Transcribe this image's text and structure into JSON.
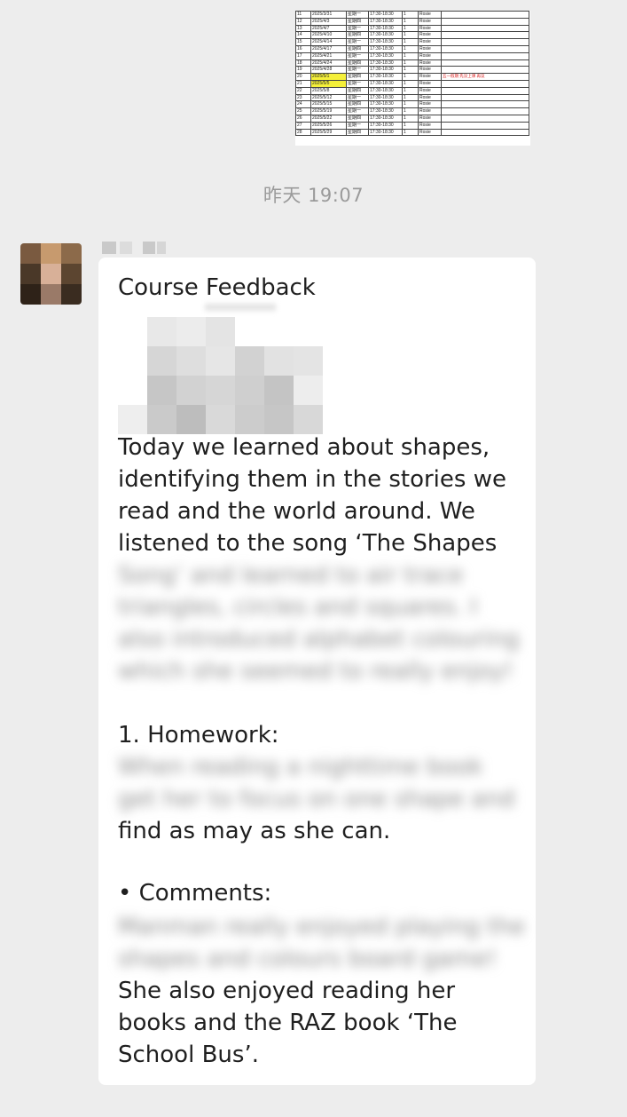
{
  "schedule": {
    "rows": [
      [
        "11",
        "2025/3/31",
        "星期一",
        "17:30-18:30",
        "1",
        "Rosie",
        ""
      ],
      [
        "12",
        "2025/4/3",
        "星期四",
        "17:30-18:30",
        "1",
        "Rosie",
        ""
      ],
      [
        "13",
        "2025/4/7",
        "星期一",
        "17:30-18:30",
        "1",
        "Rosie",
        ""
      ],
      [
        "14",
        "2025/4/10",
        "星期四",
        "17:30-18:30",
        "1",
        "Rosie",
        ""
      ],
      [
        "15",
        "2025/4/14",
        "星期一",
        "17:30-18:30",
        "1",
        "Rosie",
        ""
      ],
      [
        "16",
        "2025/4/17",
        "星期四",
        "17:30-18:30",
        "1",
        "Rosie",
        ""
      ],
      [
        "17",
        "2025/4/21",
        "星期一",
        "17:30-18:30",
        "1",
        "Rosie",
        ""
      ],
      [
        "18",
        "2025/4/24",
        "星期四",
        "17:30-18:30",
        "1",
        "Rosie",
        ""
      ],
      [
        "19",
        "2025/4/28",
        "星期一",
        "17:30-18:30",
        "1",
        "Rosie",
        ""
      ],
      [
        "20",
        "2025/5/1",
        "星期四",
        "17:30-18:30",
        "1",
        "Rosie",
        "五一假期 先没上课 再议"
      ],
      [
        "21",
        "2025/5/5",
        "星期一",
        "17:30-18:30",
        "1",
        "Rosie",
        ""
      ],
      [
        "22",
        "2025/5/8",
        "星期四",
        "17:30-18:30",
        "1",
        "Rosie",
        ""
      ],
      [
        "23",
        "2025/5/12",
        "星期一",
        "17:30-18:30",
        "1",
        "Rosie",
        ""
      ],
      [
        "24",
        "2025/5/15",
        "星期四",
        "17:30-18:30",
        "1",
        "Rosie",
        ""
      ],
      [
        "25",
        "2025/5/19",
        "星期一",
        "17:30-18:30",
        "1",
        "Rosie",
        ""
      ],
      [
        "26",
        "2025/5/22",
        "星期四",
        "17:30-18:30",
        "1",
        "Rosie",
        ""
      ],
      [
        "27",
        "2025/5/26",
        "星期一",
        "17:30-18:30",
        "1",
        "Rosie",
        ""
      ],
      [
        "28",
        "2025/5/29",
        "星期四",
        "17:30-18:30",
        "1",
        "Rosie",
        ""
      ]
    ],
    "highlighted_dates": [
      "2025/5/1",
      "2025/5/5"
    ],
    "highlight_color": "#f5f03a",
    "note_color": "#d81b1b"
  },
  "chat": {
    "timestamp": "昨天 19:07",
    "message": {
      "title": "Course Feedback",
      "para1_visible": "Today we learned about shapes, identifying them in the stories we read and the world around. We listened to the song ‘The Shapes",
      "para1_blurred": "Song’ and learned to air trace triangles, circles and squares. I also introduced alphabet colouring which she seemed to really enjoy!",
      "homework_heading": "1. Homework:",
      "homework_blurred": "When reading a nighttime book get her to focus on one shape and",
      "homework_visible": "find as may as she can.",
      "comments_heading": "• Comments:",
      "comments_blurred": "Manman really enjoyed playing the shapes and colours board game!",
      "comments_visible": "She also enjoyed reading her books and the RAZ book ‘The School Bus’."
    }
  },
  "colors": {
    "background": "#ededed",
    "bubble": "#ffffff",
    "text": "#1f1f1f",
    "timestamp": "#9a9a9a"
  }
}
